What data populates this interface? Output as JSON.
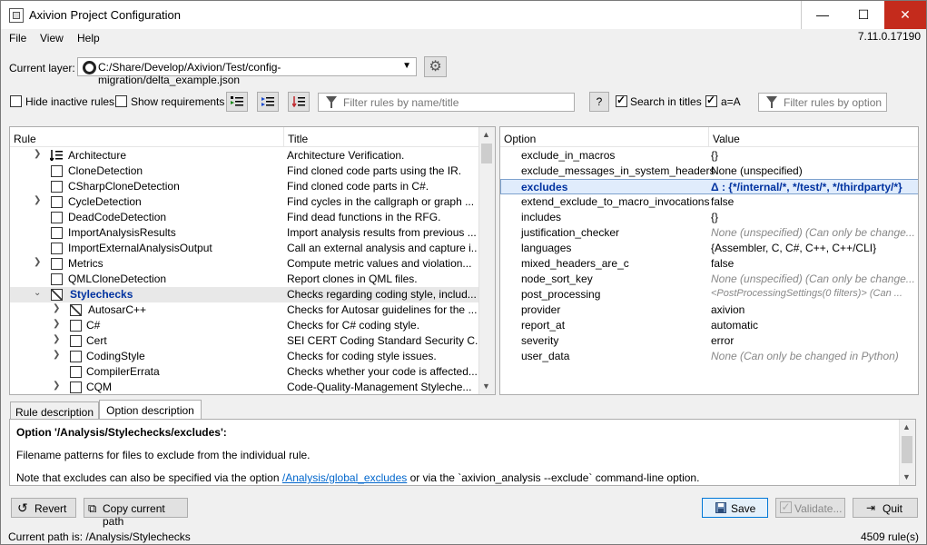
{
  "window": {
    "title": "Axivion Project Configuration",
    "minimize": "—",
    "maximize": "☐",
    "close": "✕"
  },
  "menu": [
    "File",
    "View",
    "Help"
  ],
  "version": "7.11.0.17190",
  "layer": {
    "label": "Current layer:",
    "path": "C:/Share/Develop/Axivion/Test/config-migration/delta_example.json"
  },
  "filters": {
    "hide_inactive": "Hide inactive rules",
    "show_requirements": "Show requirements",
    "rule_filter_placeholder": "Filter rules by name/title",
    "help_button": "?",
    "search_in_titles": "Search in titles",
    "case_sensitive": "a=A",
    "option_filter_placeholder": "Filter rules by option"
  },
  "rules_table": {
    "headers": [
      "Rule",
      "Title"
    ],
    "rows": [
      {
        "name": "Architecture",
        "title": "Architecture Verification."
      },
      {
        "name": "CloneDetection",
        "title": "Find cloned code parts using the IR."
      },
      {
        "name": "CSharpCloneDetection",
        "title": "Find cloned code parts in C#."
      },
      {
        "name": "CycleDetection",
        "title": "Find cycles in the callgraph or graph ..."
      },
      {
        "name": "DeadCodeDetection",
        "title": "Find dead functions in the RFG."
      },
      {
        "name": "ImportAnalysisResults",
        "title": "Import analysis results from previous ..."
      },
      {
        "name": "ImportExternalAnalysisOutput",
        "title": "Call an external analysis and capture i..."
      },
      {
        "name": "Metrics",
        "title": "Compute metric values and violation..."
      },
      {
        "name": "QMLCloneDetection",
        "title": "Report clones in QML files."
      },
      {
        "name": "Stylechecks",
        "title": "Checks regarding coding style, includ..."
      },
      {
        "name": "AutosarC++",
        "title": "Checks for Autosar guidelines for the ..."
      },
      {
        "name": "C#",
        "title": "Checks for C# coding style."
      },
      {
        "name": "Cert",
        "title": "SEI CERT Coding Standard Security C..."
      },
      {
        "name": "CodingStyle",
        "title": "Checks for coding style issues."
      },
      {
        "name": "CompilerErrata",
        "title": "Checks whether your code is affected..."
      },
      {
        "name": "CQM",
        "title": "Code-Quality-Management Styleche..."
      }
    ]
  },
  "options_table": {
    "headers": [
      "Option",
      "Value"
    ],
    "rows": [
      {
        "name": "exclude_in_macros",
        "value": "{}"
      },
      {
        "name": "exclude_messages_in_system_headers",
        "value": "None (unspecified)"
      },
      {
        "name": "excludes",
        "value": "Δ : {*/internal/*, */test/*, */thirdparty/*}"
      },
      {
        "name": "extend_exclude_to_macro_invocations",
        "value": "false"
      },
      {
        "name": "includes",
        "value": "{}"
      },
      {
        "name": "justification_checker",
        "value": "None (unspecified) (Can only be change..."
      },
      {
        "name": "languages",
        "value": "{Assembler, C, C#, C++, C++/CLI}"
      },
      {
        "name": "mixed_headers_are_c",
        "value": "false"
      },
      {
        "name": "node_sort_key",
        "value": "None (unspecified) (Can only be change..."
      },
      {
        "name": "post_processing",
        "value": "<PostProcessingSettings(0 filters)> (Can ..."
      },
      {
        "name": "provider",
        "value": "axivion"
      },
      {
        "name": "report_at",
        "value": "automatic"
      },
      {
        "name": "severity",
        "value": "error"
      },
      {
        "name": "user_data",
        "value": "None (Can only be changed in Python)"
      }
    ]
  },
  "tabs": [
    "Rule description",
    "Option description"
  ],
  "description": {
    "heading": "Option '/Analysis/Stylechecks/excludes':",
    "line1": "Filename patterns for files to exclude from the individual rule.",
    "line2_pre": "Note that excludes can also be specified via the option ",
    "line2_link": "/Analysis/global_excludes",
    "line2_post": " or via the `axivion_analysis --exclude` command-line option."
  },
  "buttons": {
    "revert": "Revert",
    "copy_path": "Copy current path",
    "save": "Save",
    "validate": "Validate...",
    "quit": "Quit"
  },
  "status": {
    "path": "Current path is: /Analysis/Stylechecks",
    "rule_count": "4509 rule(s)"
  }
}
